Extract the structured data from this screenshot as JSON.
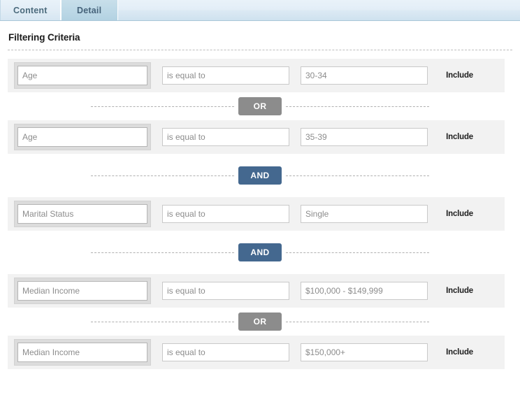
{
  "tabs": [
    {
      "label": "Content",
      "active": false
    },
    {
      "label": "Detail",
      "active": true
    }
  ],
  "section": {
    "title": "Filtering Criteria"
  },
  "colors": {
    "or_chip": "#8c8c8c",
    "and_chip": "#44688f",
    "row_background": "#f2f2f2",
    "active_tab": "#bcd8e6"
  },
  "criteria": [
    {
      "field": "Age",
      "operator": "is equal to",
      "value": "30-34",
      "mode": "Include"
    },
    {
      "field": "Age",
      "operator": "is equal to",
      "value": "35-39",
      "mode": "Include"
    },
    {
      "field": "Marital Status",
      "operator": "is equal to",
      "value": "Single",
      "mode": "Include"
    },
    {
      "field": "Median Income",
      "operator": "is equal to",
      "value": "$100,000 - $149,999",
      "mode": "Include"
    },
    {
      "field": "Median Income",
      "operator": "is equal to",
      "value": "$150,000+",
      "mode": "Include"
    }
  ],
  "separators": [
    {
      "label": "OR",
      "type": "or"
    },
    {
      "label": "AND",
      "type": "and"
    },
    {
      "label": "AND",
      "type": "and"
    },
    {
      "label": "OR",
      "type": "or"
    }
  ]
}
